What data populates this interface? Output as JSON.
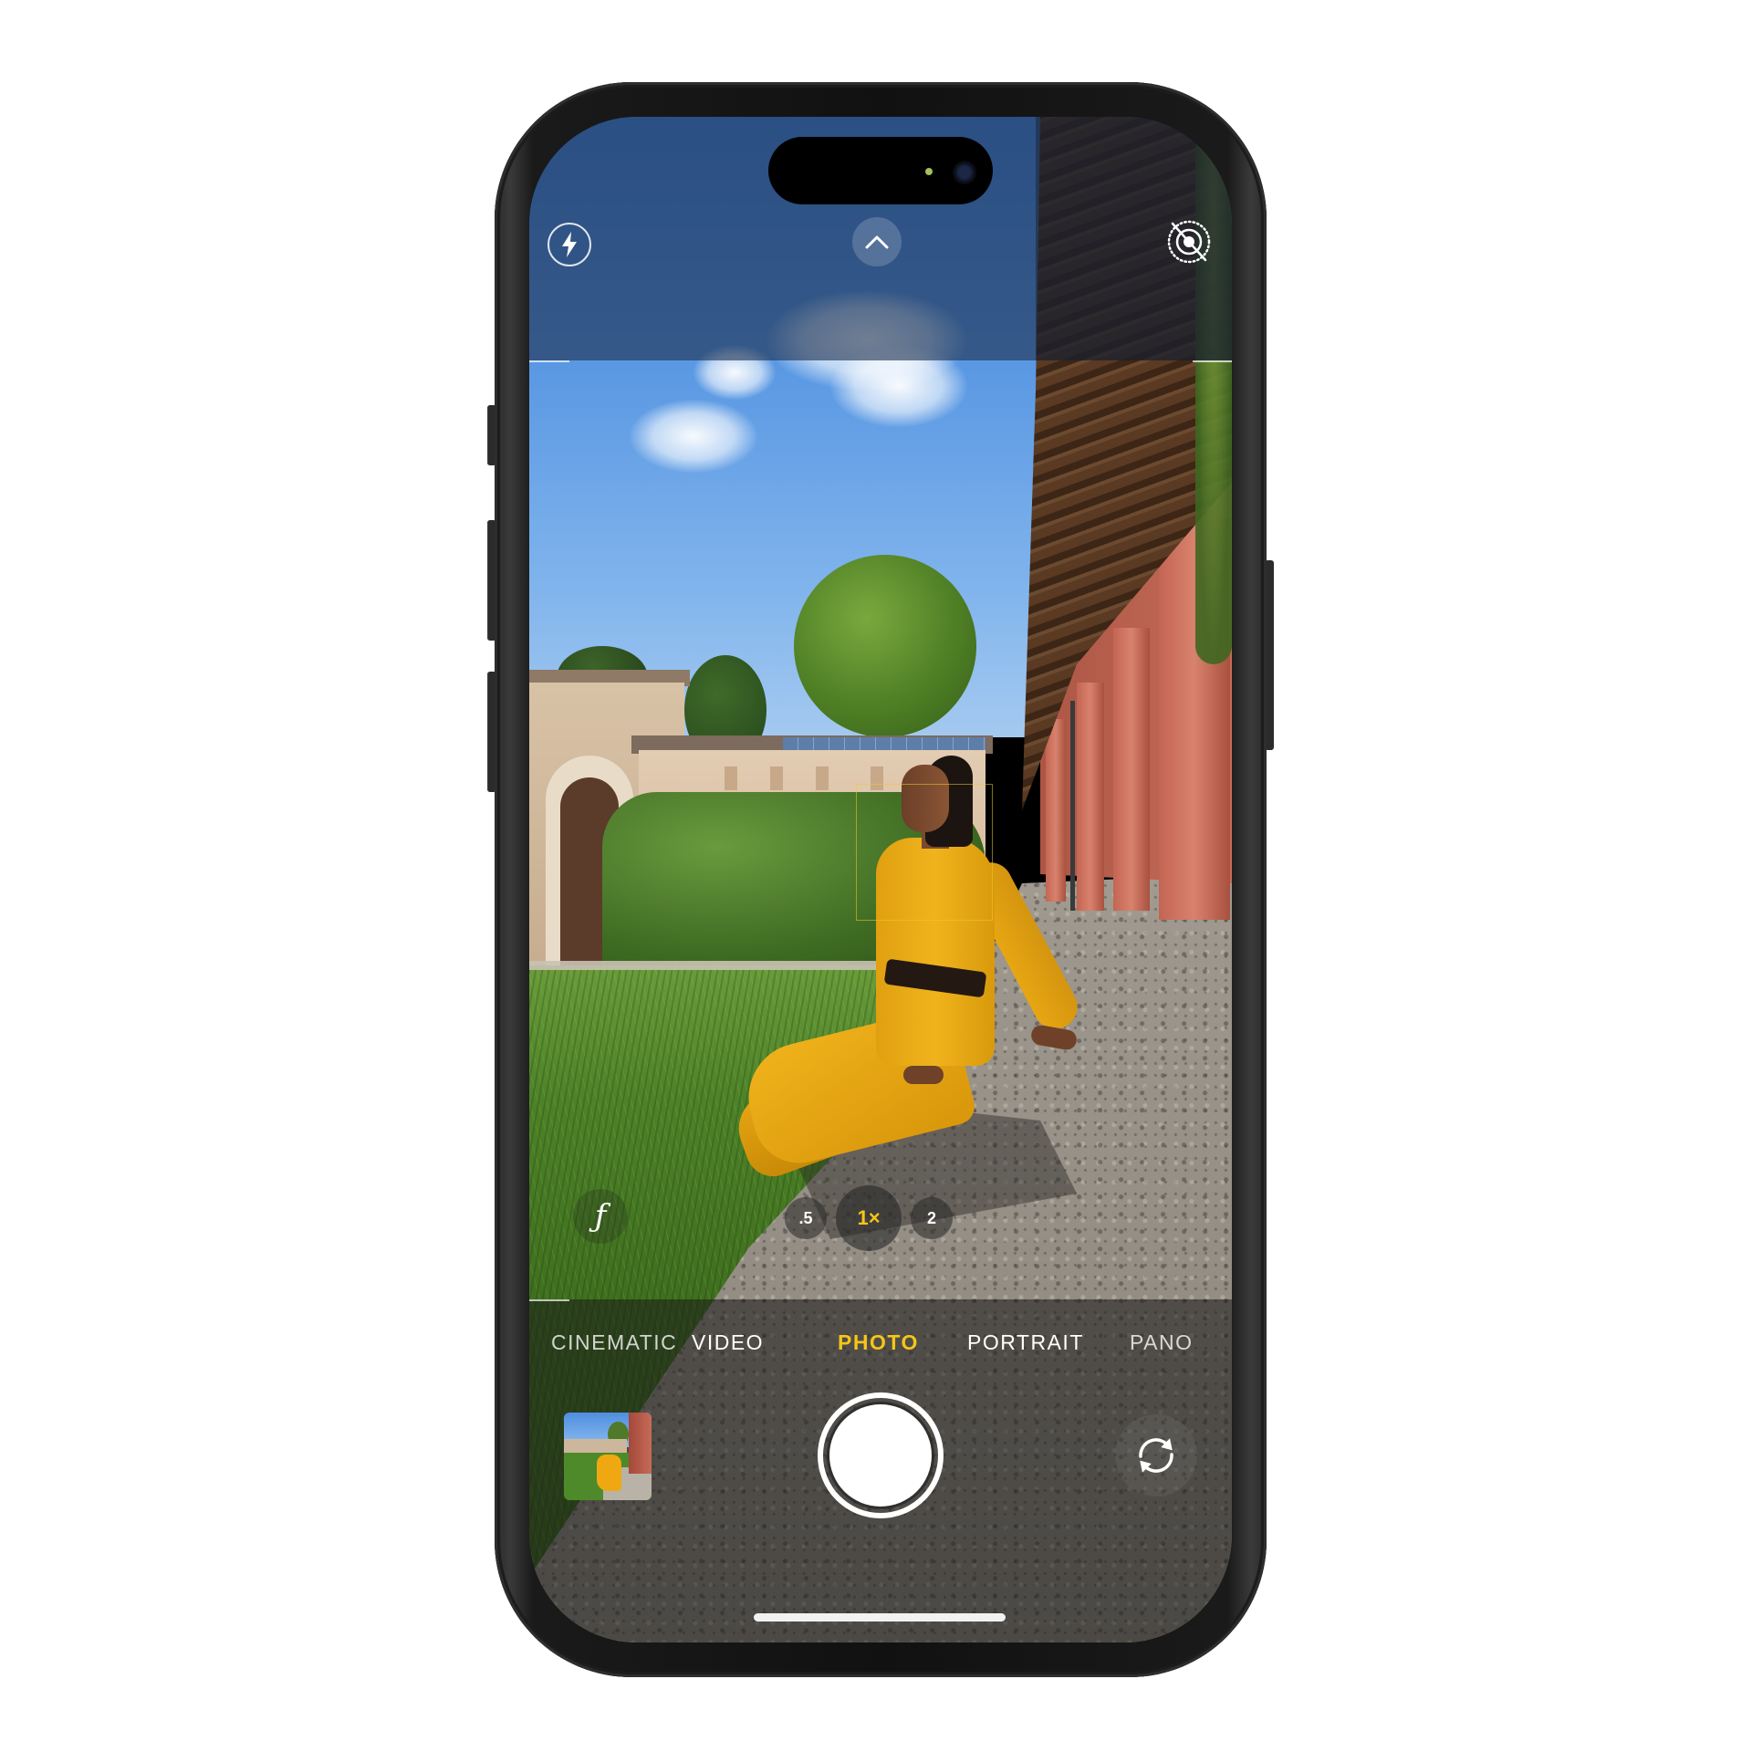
{
  "device": "iPhone",
  "app": "Camera",
  "top_controls": {
    "flash": {
      "icon": "flash-icon",
      "label": "Flash"
    },
    "controls_toggle": {
      "icon": "chevron-up-icon",
      "label": "Show camera controls"
    },
    "live_photo": {
      "icon": "live-photo-off-icon",
      "label": "Live Photo Off"
    }
  },
  "viewfinder": {
    "subject_focus": "face-detected",
    "focus_color": "#f5c518"
  },
  "aperture_control": {
    "glyph": "ƒ",
    "icon": "aperture-icon"
  },
  "zoom_levels": [
    {
      "label": ".5",
      "active": false
    },
    {
      "label": "1×",
      "active": true
    },
    {
      "label": "2",
      "active": false
    }
  ],
  "modes": [
    {
      "label": "CINEMATIC",
      "active": false
    },
    {
      "label": "VIDEO",
      "active": false
    },
    {
      "label": "PHOTO",
      "active": true
    },
    {
      "label": "PORTRAIT",
      "active": false
    },
    {
      "label": "PANO",
      "active": false
    }
  ],
  "bottom_controls": {
    "last_photo_thumbnail": {
      "label": "Last photo"
    },
    "shutter": {
      "label": "Take Photo"
    },
    "switch_camera": {
      "icon": "camera-flip-icon",
      "label": "Switch camera"
    }
  },
  "colors": {
    "accent_yellow": "#f5c518",
    "ui_white": "#ffffff"
  }
}
